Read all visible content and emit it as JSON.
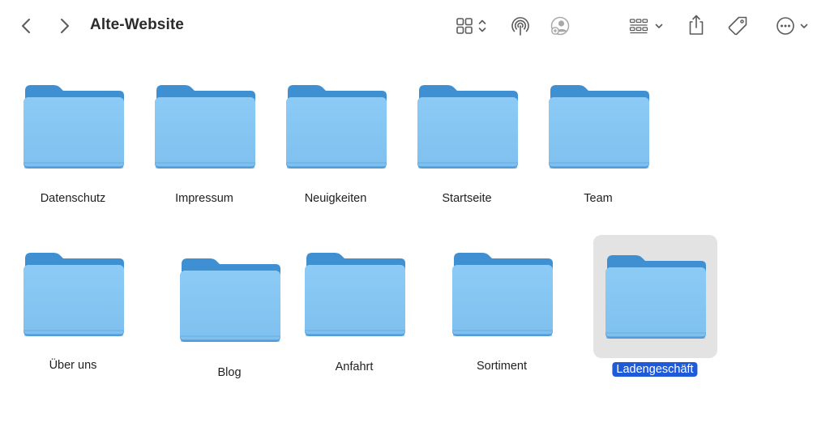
{
  "window": {
    "title": "Alte-Website"
  },
  "toolbar": {
    "back_icon": "chevron-left-icon",
    "forward_icon": "chevron-right-icon",
    "view_icon": "grid-view-icon",
    "airdrop_icon": "airdrop-icon",
    "share_person_icon": "person-share-icon",
    "group_icon": "group-by-icon",
    "share_icon": "share-icon",
    "tag_icon": "tag-icon",
    "more_icon": "ellipsis-circle-icon"
  },
  "colors": {
    "folder_front": "#8ccbf6",
    "folder_back": "#3f8fd3",
    "selection_bg": "#e3e3e3",
    "selection_label": "#1f5ad9"
  },
  "folders": [
    {
      "name": "Datenschutz",
      "selected": false
    },
    {
      "name": "Impressum",
      "selected": false
    },
    {
      "name": "Neuigkeiten",
      "selected": false
    },
    {
      "name": "Startseite",
      "selected": false
    },
    {
      "name": "Team",
      "selected": false
    },
    {
      "name": "Über uns",
      "selected": false
    },
    {
      "name": "Blog",
      "selected": false
    },
    {
      "name": "Anfahrt",
      "selected": false
    },
    {
      "name": "Sortiment",
      "selected": false
    },
    {
      "name": "Ladengeschäft",
      "selected": true
    }
  ]
}
